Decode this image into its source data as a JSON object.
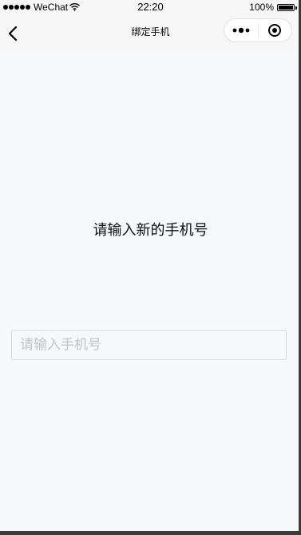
{
  "status_bar": {
    "carrier": "WeChat",
    "time": "22:20",
    "battery_percent": "100%",
    "signal_icon": "signal-dots-icon",
    "wifi_icon": "wifi-icon",
    "battery_icon": "battery-icon",
    "battery_level": 1.0
  },
  "nav": {
    "title": "绑定手机",
    "back_icon": "back-chevron-icon",
    "more_icon": "more-dots-icon",
    "close_icon": "close-circle-icon"
  },
  "main": {
    "prompt": "请输入新的手机号",
    "phone_input": {
      "placeholder": "请输入手机号",
      "value": ""
    }
  },
  "colors": {
    "background": "#f7f8fb",
    "nav_background": "#f7f7f7",
    "input_border": "#d7d9df",
    "placeholder": "#c2c4c9"
  }
}
